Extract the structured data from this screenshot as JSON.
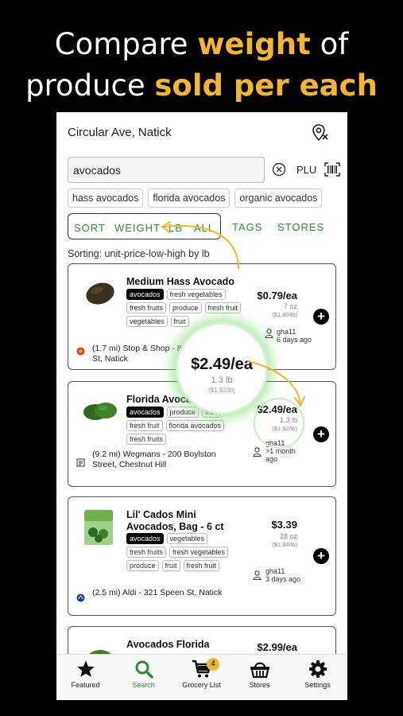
{
  "headline": {
    "line1_a": "Compare ",
    "line1_b": "weight",
    "line1_c": " of",
    "line2_a": "produce ",
    "line2_b": "sold per each"
  },
  "location": {
    "text": "Circular Ave, Natick",
    "icon": "map-pin-location-icon"
  },
  "search": {
    "value": "avocados",
    "plu_label": "PLU"
  },
  "suggestions": [
    "hass avocados",
    "florida avocados",
    "organic avocados"
  ],
  "sort_bar": {
    "sort": "SORT",
    "weight": "WEIGHT",
    "lb": "LB",
    "all": "ALL",
    "tags": "TAGS",
    "stores": "STORES"
  },
  "sorting_text": "Sorting: unit-price-low-high by lb",
  "products": [
    {
      "name": "Medium Hass Avocado",
      "tags": [
        "avocados",
        "fresh vegetables",
        "fresh fruits",
        "produce",
        "fresh fruit",
        "vegetables",
        "fruit"
      ],
      "price": "$0.79/ea",
      "weight": "7 oz",
      "per_lb": "($1.80/lb)",
      "user": "gha11",
      "when": "6 days ago",
      "store": "(1.7 mi) Stop & Shop - 8 Worcester St, Natick"
    },
    {
      "name": "Florida Avocado",
      "tags": [
        "avocados",
        "produce",
        "fruit",
        "fresh fruit",
        "florida avocados",
        "fresh fruits"
      ],
      "price": "$2.49/ea",
      "weight": "1.3 lb",
      "per_lb": "($1.92/lb)",
      "user": "gha11",
      "when": ">1 month ago",
      "store": "(9.2 mi) Wegmans - 200 Boylston Street, Chestnut Hill"
    },
    {
      "name": "Lil' Cados Mini Avocados, Bag - 6 ct",
      "tags": [
        "avocados",
        "vegetables",
        "fresh fruits",
        "fresh vegetables",
        "produce",
        "fruit",
        "fresh fruit"
      ],
      "price": "$3.39",
      "weight": "28 oz",
      "per_lb": "($1.94/lb)",
      "user": "gha11",
      "when": "3 days ago",
      "store": "(2.5 mi) Aldi - 321 Speen St, Natick"
    },
    {
      "name": "Avocados Florida",
      "price": "$2.99/ea"
    }
  ],
  "magnifier": {
    "price": "$2.49/ea",
    "weight": "1.3 lb",
    "per_lb": "($1.92/lb)"
  },
  "nav": [
    {
      "label": "Featured",
      "icon": "star-icon"
    },
    {
      "label": "Search",
      "icon": "search-icon"
    },
    {
      "label": "Grocery List",
      "icon": "cart-icon",
      "badge": "4"
    },
    {
      "label": "Stores",
      "icon": "basket-icon"
    },
    {
      "label": "Settings",
      "icon": "gear-icon"
    }
  ],
  "colors": {
    "accent": "#f5b52d",
    "green": "#2e8b3a",
    "background": "#000000"
  }
}
